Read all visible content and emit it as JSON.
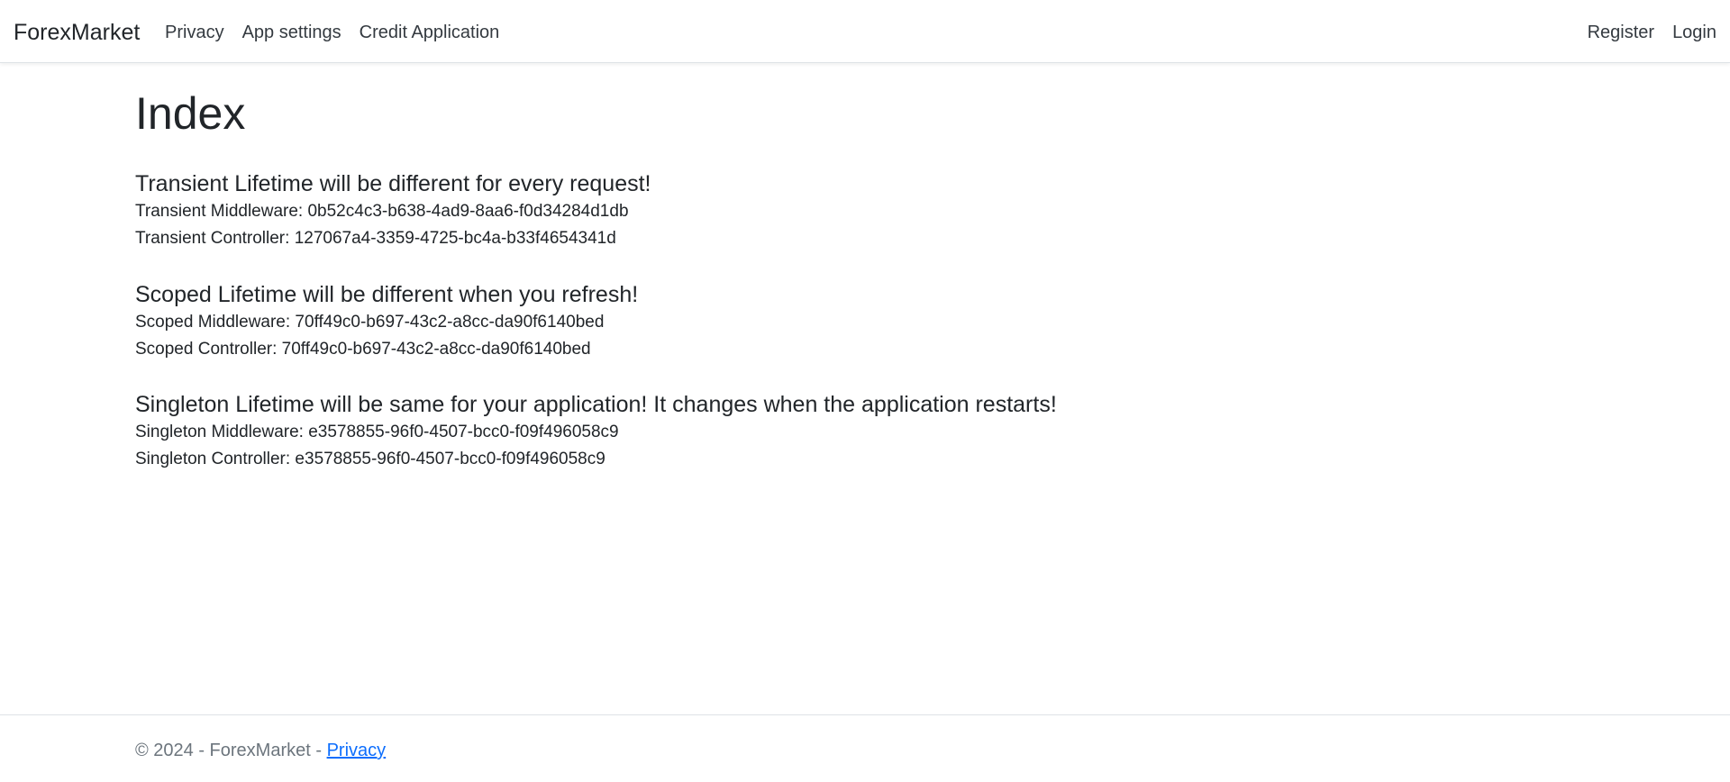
{
  "navbar": {
    "brand": "ForexMarket",
    "left_links": [
      "Privacy",
      "App settings",
      "Credit Application"
    ],
    "right_links": [
      "Register",
      "Login"
    ]
  },
  "main": {
    "title": "Index",
    "sections": [
      {
        "heading": "Transient Lifetime will be different for every request!",
        "lines": [
          "Transient Middleware: 0b52c4c3-b638-4ad9-8aa6-f0d34284d1db",
          "Transient Controller: 127067a4-3359-4725-bc4a-b33f4654341d"
        ]
      },
      {
        "heading": "Scoped Lifetime will be different when you refresh!",
        "lines": [
          "Scoped Middleware: 70ff49c0-b697-43c2-a8cc-da90f6140bed",
          "Scoped Controller: 70ff49c0-b697-43c2-a8cc-da90f6140bed"
        ]
      },
      {
        "heading": "Singleton Lifetime will be same for your application! It changes when the application restarts!",
        "lines": [
          "Singleton Middleware: e3578855-96f0-4507-bcc0-f09f496058c9",
          "Singleton Controller: e3578855-96f0-4507-bcc0-f09f496058c9"
        ]
      }
    ]
  },
  "footer": {
    "text": "© 2024 - ForexMarket - ",
    "link": "Privacy"
  },
  "colors": {
    "link": "#0d6efd",
    "muted": "#6c757d",
    "text": "#212529"
  }
}
